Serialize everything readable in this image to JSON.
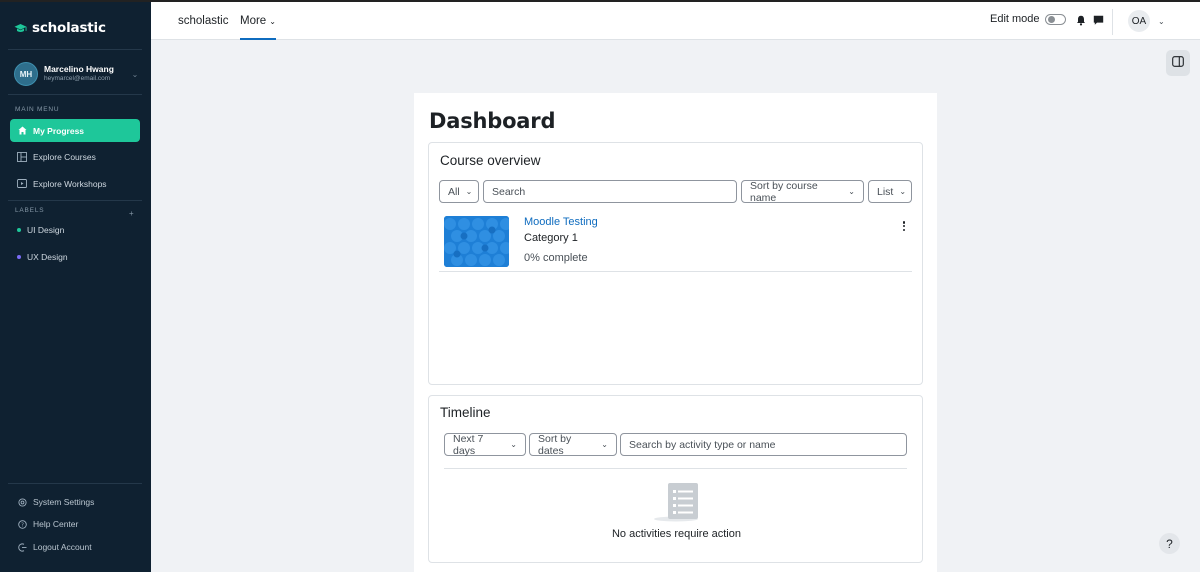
{
  "brand": {
    "name": "scholastic"
  },
  "profile": {
    "initials": "MH",
    "name": "Marcelino Hwang",
    "email": "heymarcel@email.com"
  },
  "sidebar": {
    "main_menu_label": "MAIN MENU",
    "items": [
      {
        "label": "My Progress",
        "icon": "home-icon",
        "active": true
      },
      {
        "label": "Explore Courses",
        "icon": "grid-icon"
      },
      {
        "label": "Explore Workshops",
        "icon": "video-icon"
      }
    ],
    "labels_label": "LABELS",
    "labels": [
      {
        "label": "UI Design",
        "color": "#1ec79a"
      },
      {
        "label": "UX Design",
        "color": "#7b6cf6"
      }
    ],
    "bottom": [
      {
        "label": "System Settings",
        "icon": "gear-icon"
      },
      {
        "label": "Help Center",
        "icon": "help-circle-icon"
      },
      {
        "label": "Logout Account",
        "icon": "logout-icon"
      }
    ]
  },
  "header": {
    "site_name": "scholastic",
    "more_label": "More",
    "edit_mode_label": "Edit mode",
    "user_initials": "OA"
  },
  "dashboard": {
    "title": "Dashboard",
    "course_overview": {
      "title": "Course overview",
      "filter": "All",
      "search_placeholder": "Search",
      "sort": "Sort by course name",
      "view": "List",
      "courses": [
        {
          "name": "Moodle Testing",
          "category": "Category 1",
          "progress_text": "0% complete",
          "progress": 0
        }
      ]
    },
    "timeline": {
      "title": "Timeline",
      "range": "Next 7 days",
      "sort": "Sort by dates",
      "search_placeholder": "Search by activity type or name",
      "empty_text": "No activities require action"
    }
  },
  "colors": {
    "sidebar_bg": "#0f2131",
    "accent": "#1ec79a",
    "link": "#0f6cbf"
  }
}
